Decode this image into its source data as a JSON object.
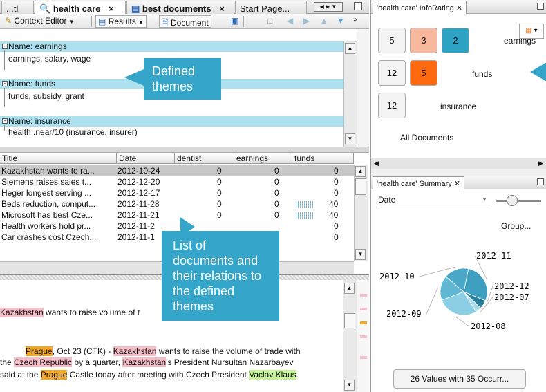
{
  "tabs": [
    {
      "label": "...tl"
    },
    {
      "label": "health care",
      "close": "×"
    },
    {
      "label": "best documents",
      "close": "×"
    },
    {
      "label": "Start Page..."
    }
  ],
  "toolbar": {
    "context_editor": "Context Editor",
    "results": "Results",
    "document": "Document"
  },
  "themes": [
    {
      "name": "Name: earnings",
      "definition": "earnings, salary, wage"
    },
    {
      "name": "Name: funds",
      "definition": "funds, subsidy, grant"
    },
    {
      "name": "Name: insurance",
      "definition": "health .near/10 (insurance, insurer)"
    }
  ],
  "callouts": {
    "themes": "Defined\nthemes",
    "docs": "List of\ndocuments and\ntheir relations to\nthe defined\nthemes"
  },
  "table": {
    "headers": [
      "Title",
      "Date",
      "dentist",
      "earnings",
      "funds"
    ],
    "rows": [
      {
        "title": "Kazakhstan wants to ra...",
        "date": "2012-10-24",
        "dentist": "0",
        "earnings": "0",
        "funds": "0"
      },
      {
        "title": "Siemens raises sales t...",
        "date": "2012-12-20",
        "dentist": "0",
        "earnings": "0",
        "funds": "0"
      },
      {
        "title": "Heger longest serving ...",
        "date": "2012-12-17",
        "dentist": "0",
        "earnings": "0",
        "funds": "0"
      },
      {
        "title": "Beds reduction, comput...",
        "date": "2012-11-28",
        "dentist": "0",
        "earnings": "0",
        "funds": "40"
      },
      {
        "title": "Microsoft has best Cze...",
        "date": "2012-11-21",
        "dentist": "0",
        "earnings": "0",
        "funds": "40"
      },
      {
        "title": "Health workers hold pr...",
        "date": "2012-11-2",
        "dentist": "",
        "earnings": "",
        "funds": "0"
      },
      {
        "title": "Car crashes cost Czech...",
        "date": "2012-11-1",
        "dentist": "",
        "earnings": "",
        "funds": "0"
      }
    ]
  },
  "document": {
    "line1": {
      "hl": "Kazakhstan",
      "rest": " wants to raise volume of t"
    },
    "line2": {
      "a": "Prague",
      "b": ", Oct 23 (CTK) - ",
      "c": "Kazakhstan",
      "d": " wants to raise the volume of trade with"
    },
    "line3": {
      "a": "the ",
      "b": "Czech Republic",
      "c": " by a quarter, ",
      "d": "Kazakhstan",
      "e": "'s President Nursultan Nazarbayev"
    },
    "line4": {
      "a": "said at the ",
      "b": "Prague",
      "c": " Castle today after meeting with Czech President ",
      "d": "Vaclav Klaus",
      "e": "."
    }
  },
  "inforating": {
    "tab": "'health care' InfoRating",
    "rows": [
      {
        "values": [
          "5",
          "3",
          "2"
        ],
        "label": "earnings"
      },
      {
        "values": [
          "12",
          "5"
        ],
        "label": "funds"
      },
      {
        "values": [
          "12"
        ],
        "label": "insurance"
      }
    ],
    "all": "All Documents"
  },
  "summary": {
    "tab": "'health care' Summary",
    "field": "Date",
    "group": "Group...",
    "footer": "26 Values with 35 Occurr..."
  },
  "chart_data": {
    "type": "pie",
    "labels": [
      "2012-11",
      "2012-12",
      "2012-07",
      "2012-08",
      "2012-09",
      "2012-10"
    ],
    "values": [
      28,
      6,
      4,
      28,
      17,
      17
    ],
    "colors": [
      "#3f9fc0",
      "#2a7f9c",
      "#a8dceb",
      "#8ccfe4",
      "#5fb7d4",
      "#4aa7c7"
    ]
  }
}
